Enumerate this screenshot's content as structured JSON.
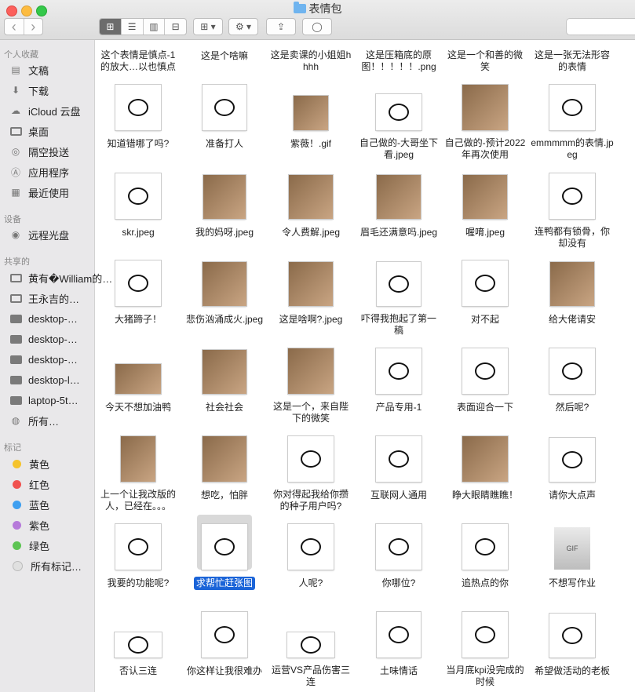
{
  "window": {
    "title": "表情包"
  },
  "toolbar": {
    "back": "‹",
    "forward": "›",
    "view_icons": "⊞",
    "view_list": "☰",
    "view_columns": "▥",
    "view_gallery": "⊟",
    "arrange": "⊞ ▾",
    "action": "⚙ ▾",
    "share": "⇪",
    "tag": "◯"
  },
  "sidebar": {
    "favorites_header": "个人收藏",
    "favorites": [
      {
        "label": "文稿",
        "icon": "document-icon"
      },
      {
        "label": "下载",
        "icon": "download-icon"
      },
      {
        "label": "iCloud 云盘",
        "icon": "cloud-icon"
      },
      {
        "label": "桌面",
        "icon": "desktop-icon"
      },
      {
        "label": "隔空投送",
        "icon": "airdrop-icon"
      },
      {
        "label": "应用程序",
        "icon": "applications-icon"
      },
      {
        "label": "最近使用",
        "icon": "recents-icon"
      }
    ],
    "devices_header": "设备",
    "devices": [
      {
        "label": "远程光盘",
        "icon": "disc-icon"
      }
    ],
    "shared_header": "共享的",
    "shared": [
      {
        "label": "黄有�William的…"
      },
      {
        "label": "王永吉的…"
      },
      {
        "label": "desktop-…"
      },
      {
        "label": "desktop-…"
      },
      {
        "label": "desktop-…"
      },
      {
        "label": "desktop-l…"
      },
      {
        "label": "laptop-5t…"
      },
      {
        "label": "所有…"
      }
    ],
    "tags_header": "标记",
    "tags": [
      {
        "label": "黄色",
        "color": "#f5c32c"
      },
      {
        "label": "红色",
        "color": "#f0524f"
      },
      {
        "label": "蓝色",
        "color": "#3e9ff0"
      },
      {
        "label": "紫色",
        "color": "#b67ada"
      },
      {
        "label": "绿色",
        "color": "#5dc453"
      },
      {
        "label": "所有标记…",
        "color": "#e0e0e0"
      }
    ]
  },
  "files": [
    [
      "这个表情是慎点-1的放大…以也慎点",
      "这是个啥嘛",
      "这是卖课的小姐姐hhhh",
      "这是压箱底的原图！！！！！.png",
      "这是一个和善的微笑",
      "这是一张无法形容的表情"
    ],
    [
      "知道错哪了吗?",
      "准备打人",
      "紫薇！.gif",
      "自己做的-大哥坐下看.jpeg",
      "自己做的-预计2022年再次使用",
      "emmmmm的表情.jpeg"
    ],
    [
      "skr.jpeg",
      "我的妈呀.jpeg",
      "令人费解.jpeg",
      "眉毛还满意吗.jpeg",
      "喔唷.jpeg",
      "连鸭都有锁骨，你却没有"
    ],
    [
      "大猪蹄子！",
      "悲伤汹涌成火.jpeg",
      "这是啥啊?.jpeg",
      "吓得我抱起了第一稿",
      "对不起",
      "给大佬请安"
    ],
    [
      "今天不想加油鸭",
      "社会社会",
      "这是一个，来自陛下的微笑",
      "产品专用-1",
      "表面迎合一下",
      "然后呢?"
    ],
    [
      "上一个让我改版的人，已经在。。。",
      "想吃，怕胖",
      "你对得起我给你攒的种子用户吗?",
      "互联网人通用",
      "睁大眼睛瞧瞧！",
      "请你大点声"
    ],
    [
      "我要的功能呢?",
      "求帮忙赶张图",
      "人呢?",
      "你哪位?",
      "追热点的你",
      "不想写作业"
    ],
    [
      "否认三连",
      "你这样让我很难办",
      "运营VS产品伤害三连",
      "土味情话",
      "当月底kpi没完成的时候",
      "希望做活动的老板"
    ]
  ],
  "selected_file": "求帮忙赶张图"
}
